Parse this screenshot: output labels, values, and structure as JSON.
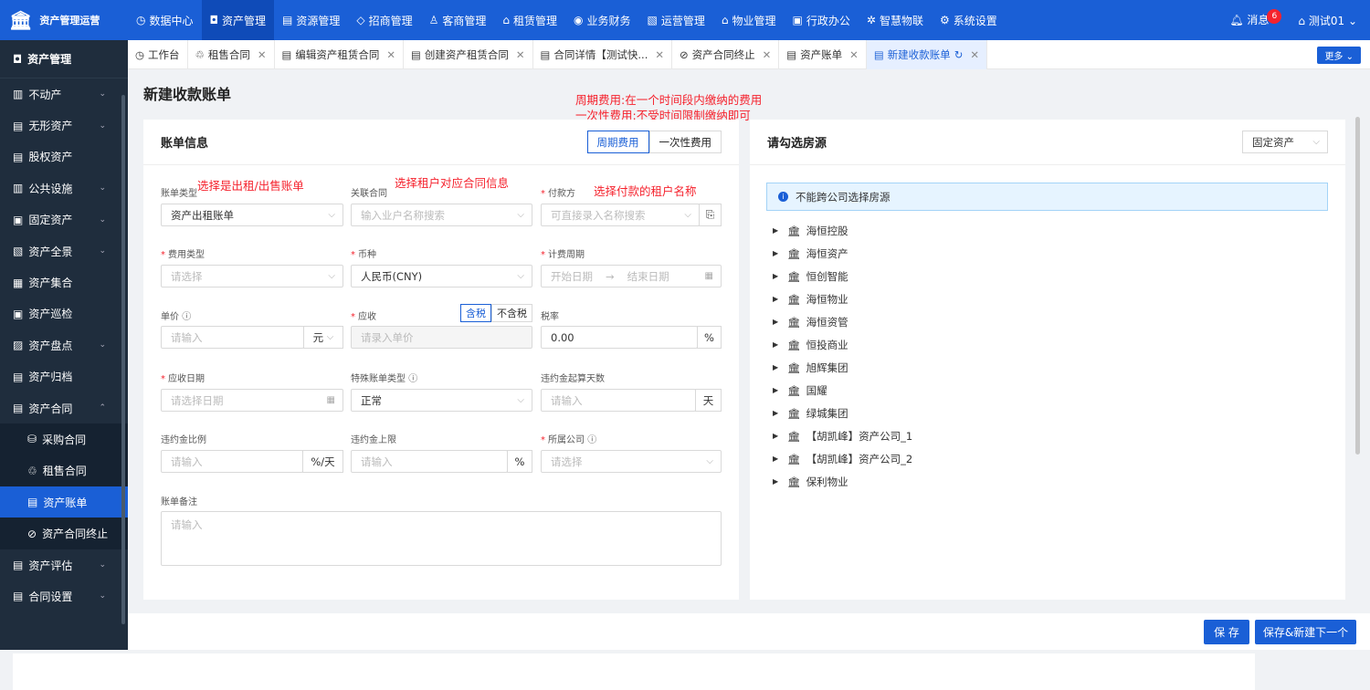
{
  "app": {
    "title": "资产管理运营"
  },
  "topnav": [
    {
      "icon": "◷",
      "label": "数据中心"
    },
    {
      "icon": "◘",
      "label": "资产管理"
    },
    {
      "icon": "▤",
      "label": "资源管理"
    },
    {
      "icon": "◇",
      "label": "招商管理"
    },
    {
      "icon": "♙",
      "label": "客商管理"
    },
    {
      "icon": "⌂",
      "label": "租赁管理"
    },
    {
      "icon": "◉",
      "label": "业务财务"
    },
    {
      "icon": "▧",
      "label": "运营管理"
    },
    {
      "icon": "⌂",
      "label": "物业管理"
    },
    {
      "icon": "▣",
      "label": "行政办公"
    },
    {
      "icon": "✲",
      "label": "智慧物联"
    },
    {
      "icon": "⚙",
      "label": "系统设置"
    }
  ],
  "top_right": {
    "messages": "消息",
    "message_count": "6",
    "user": "测试01"
  },
  "sidebar": {
    "header": "资产管理",
    "items": [
      {
        "label": "不动产",
        "chev": "⌄"
      },
      {
        "label": "无形资产",
        "chev": "⌄"
      },
      {
        "label": "股权资产",
        "chev": ""
      },
      {
        "label": "公共设施",
        "chev": "⌄"
      },
      {
        "label": "固定资产",
        "chev": "⌄"
      },
      {
        "label": "资产全景",
        "chev": "⌄"
      },
      {
        "label": "资产集合",
        "chev": ""
      },
      {
        "label": "资产巡检",
        "chev": ""
      },
      {
        "label": "资产盘点",
        "chev": "⌄"
      },
      {
        "label": "资产归档",
        "chev": ""
      },
      {
        "label": "资产合同",
        "chev": "⌃"
      }
    ],
    "sub_items": [
      "采购合同",
      "租售合同",
      "资产账单",
      "资产合同终止"
    ],
    "items_after": [
      {
        "label": "资产评估",
        "chev": "⌄"
      },
      {
        "label": "合同设置",
        "chev": "⌄"
      }
    ]
  },
  "tabs": [
    {
      "label": "工作台"
    },
    {
      "label": "租售合同"
    },
    {
      "label": "编辑资产租赁合同"
    },
    {
      "label": "创建资产租赁合同"
    },
    {
      "label": "合同详情【测试快..."
    },
    {
      "label": "资产合同终止"
    },
    {
      "label": "资产账单"
    },
    {
      "label": "新建收款账单"
    }
  ],
  "more_label": "更多 ⌄",
  "page_title": "新建收款账单",
  "annotations": {
    "period_note_1": "周期费用:在一个时间段内缴纳的费用",
    "period_note_2": "一次性费用:不受时间限制缴纳即可",
    "bill_type_note": "选择是出租/出售账单",
    "contract_note": "选择租户对应合同信息",
    "payer_note": "选择付款的租户名称"
  },
  "left_card": {
    "title": "账单信息",
    "seg_periodic": "周期费用",
    "seg_onetime": "一次性费用"
  },
  "form": {
    "bill_type_label": "账单类型",
    "bill_type_value": "资产出租账单",
    "contract_label": "关联合同",
    "contract_ph": "输入业户名称搜索",
    "payer_label": "付款方",
    "payer_ph": "可直接录入名称搜索",
    "fee_type_label": "费用类型",
    "fee_type_ph": "请选择",
    "currency_label": "币种",
    "currency_value": "人民币(CNY)",
    "period_label": "计费周期",
    "period_start": "开始日期",
    "period_end": "结束日期",
    "unit_price_label": "单价",
    "unit_price_ph": "请输入",
    "unit_price_unit": "元",
    "receivable_label": "应收",
    "tax_incl": "含税",
    "tax_excl": "不含税",
    "receivable_ph": "请录入单价",
    "tax_rate_label": "税率",
    "tax_rate_value": "0.00",
    "tax_rate_unit": "%",
    "due_date_label": "应收日期",
    "due_date_ph": "请选择日期",
    "special_label": "特殊账单类型",
    "special_value": "正常",
    "penalty_days_label": "违约金起算天数",
    "penalty_days_ph": "请输入",
    "penalty_days_unit": "天",
    "penalty_ratio_label": "违约金比例",
    "penalty_ratio_ph": "请输入",
    "penalty_ratio_unit": "%/天",
    "penalty_cap_label": "违约金上限",
    "penalty_cap_ph": "请输入",
    "penalty_cap_unit": "%",
    "company_label": "所属公司",
    "company_ph": "请选择",
    "remark_label": "账单备注",
    "remark_ph": "请输入"
  },
  "right_card": {
    "title": "请勾选房源",
    "select_value": "固定资产",
    "info": "不能跨公司选择房源",
    "tree": [
      "海恒控股",
      "海恒资产",
      "恒创智能",
      "海恒物业",
      "海恒资管",
      "恒投商业",
      "旭辉集团",
      "国耀",
      "绿城集团",
      "【胡凯峰】资产公司_1",
      "【胡凯峰】资产公司_2",
      "保利物业"
    ]
  },
  "buttons": {
    "save": "保 存",
    "save_next": "保存&新建下一个"
  }
}
